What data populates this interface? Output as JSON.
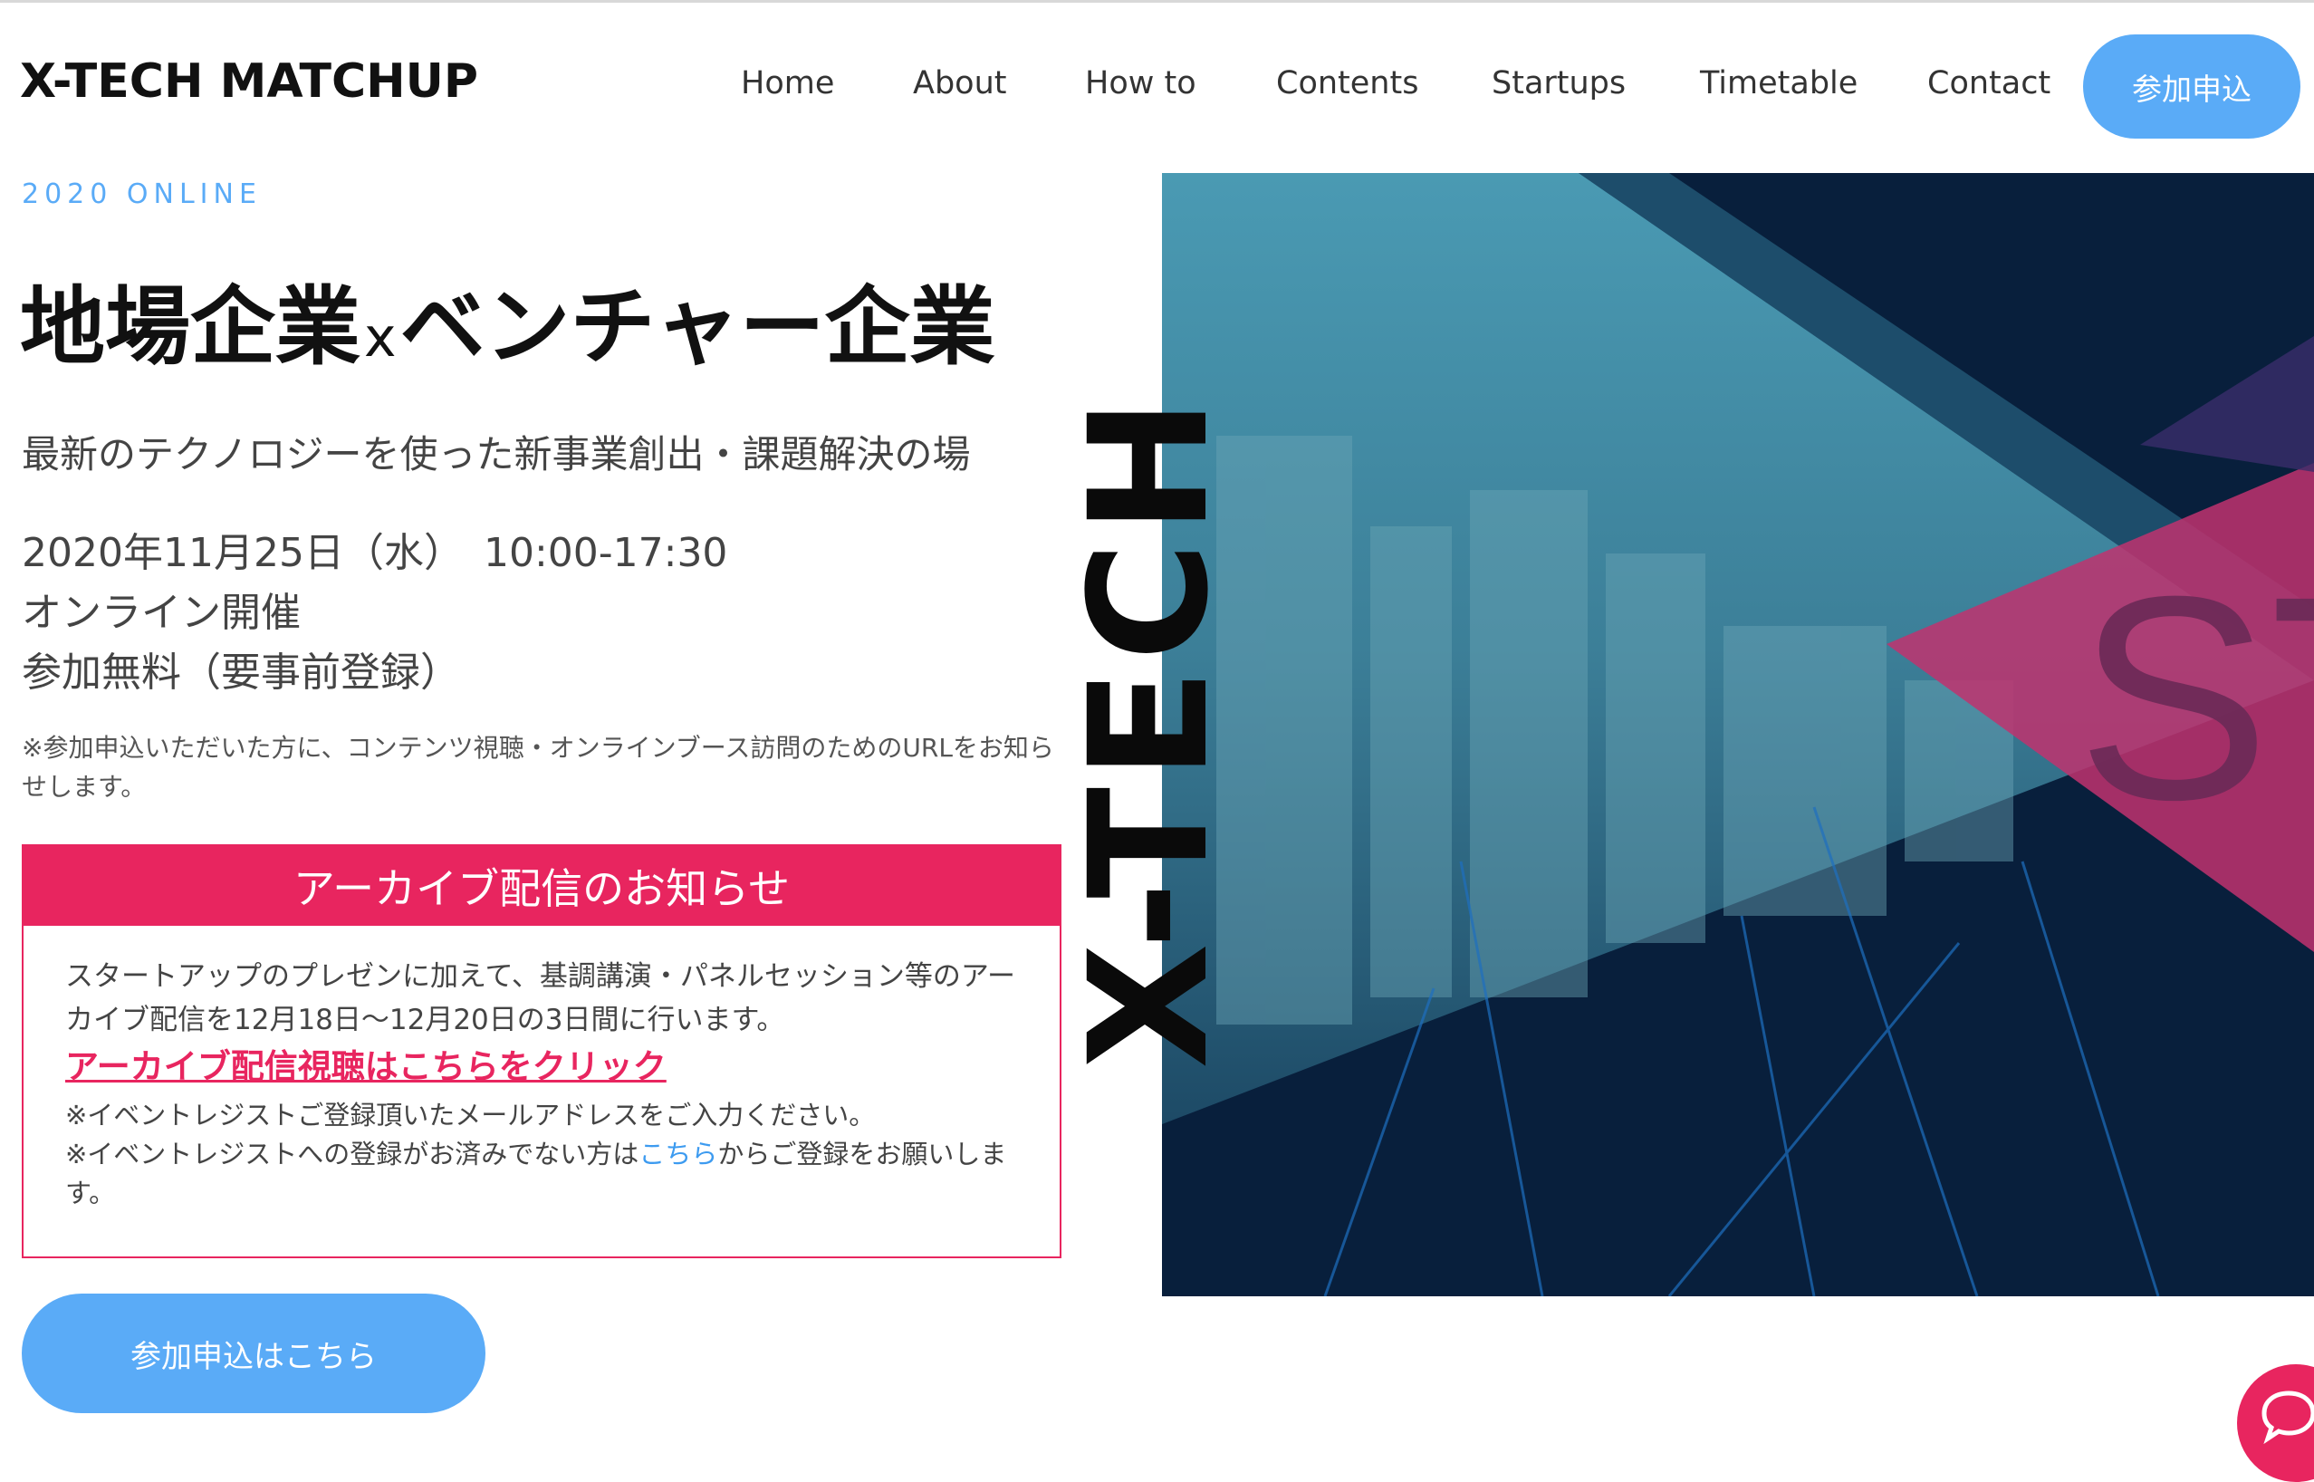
{
  "header": {
    "logo": "X-TECH MATCHUP",
    "nav": [
      "Home",
      "About",
      "How to",
      "Contents",
      "Startups",
      "Timetable",
      "Contact"
    ],
    "cta": "参加申込"
  },
  "hero": {
    "eyebrow": "2020 ONLINE",
    "headline_left": "地場企業",
    "headline_x": "x",
    "headline_right": "ベンチャー企業",
    "subline": "最新のテクノロジーを使った新事業創出・課題解決の場",
    "date": "2020年11月25日（水）　10:00-17:30",
    "venue": "オンライン開催",
    "fee": "参加無料（要事前登録）",
    "note": "※参加申込いただいた方に、コンテンツ視聴・オンラインブース訪問のためのURLをお知らせします。",
    "vertical_text": "X-TECH",
    "image_letters": "ST"
  },
  "notice": {
    "title": "アーカイブ配信のお知らせ",
    "body": "スタートアップのプレゼンに加えて、基調講演・パネルセッション等のアーカイブ配信を12月18日～12月20日の3日間に行います。",
    "link": "アーカイブ配信視聴はこちらをクリック",
    "note1": "※イベントレジストご登録頂いたメールアドレスをご入力ください。",
    "note2_pre": "※イベントレジストへの登録がお済みでない方は",
    "note2_link": "こちら",
    "note2_post": "からご登録をお願いします。"
  },
  "cta_bottom": "参加申込はこちら",
  "colors": {
    "accent_blue": "#5aabf7",
    "accent_pink": "#e8255f",
    "navy": "#0a2540"
  },
  "icons": {
    "chat": "chat-bubble-icon"
  }
}
